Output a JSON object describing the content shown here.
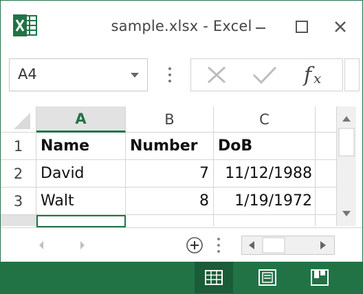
{
  "window": {
    "title": "sample.xlsx - Excel",
    "accent_color": "#217346",
    "app_icon": "excel-icon"
  },
  "formula_bar": {
    "name_box": "A4",
    "cancel_icon": "cancel-x-icon",
    "enter_icon": "enter-check-icon",
    "function_icon": "fx-icon"
  },
  "columns": [
    "A",
    "B",
    "C"
  ],
  "rows": [
    {
      "header": "1",
      "cells": [
        "Name",
        "Number",
        "DoB"
      ]
    },
    {
      "header": "2",
      "cells": [
        "David",
        "7",
        "11/12/1988"
      ]
    },
    {
      "header": "3",
      "cells": [
        "Walt",
        "8",
        "1/19/1972"
      ]
    }
  ],
  "active_column": "A",
  "status_bar": {
    "view_buttons": [
      "normal-view-icon",
      "page-layout-view-icon",
      "page-break-preview-icon"
    ]
  }
}
